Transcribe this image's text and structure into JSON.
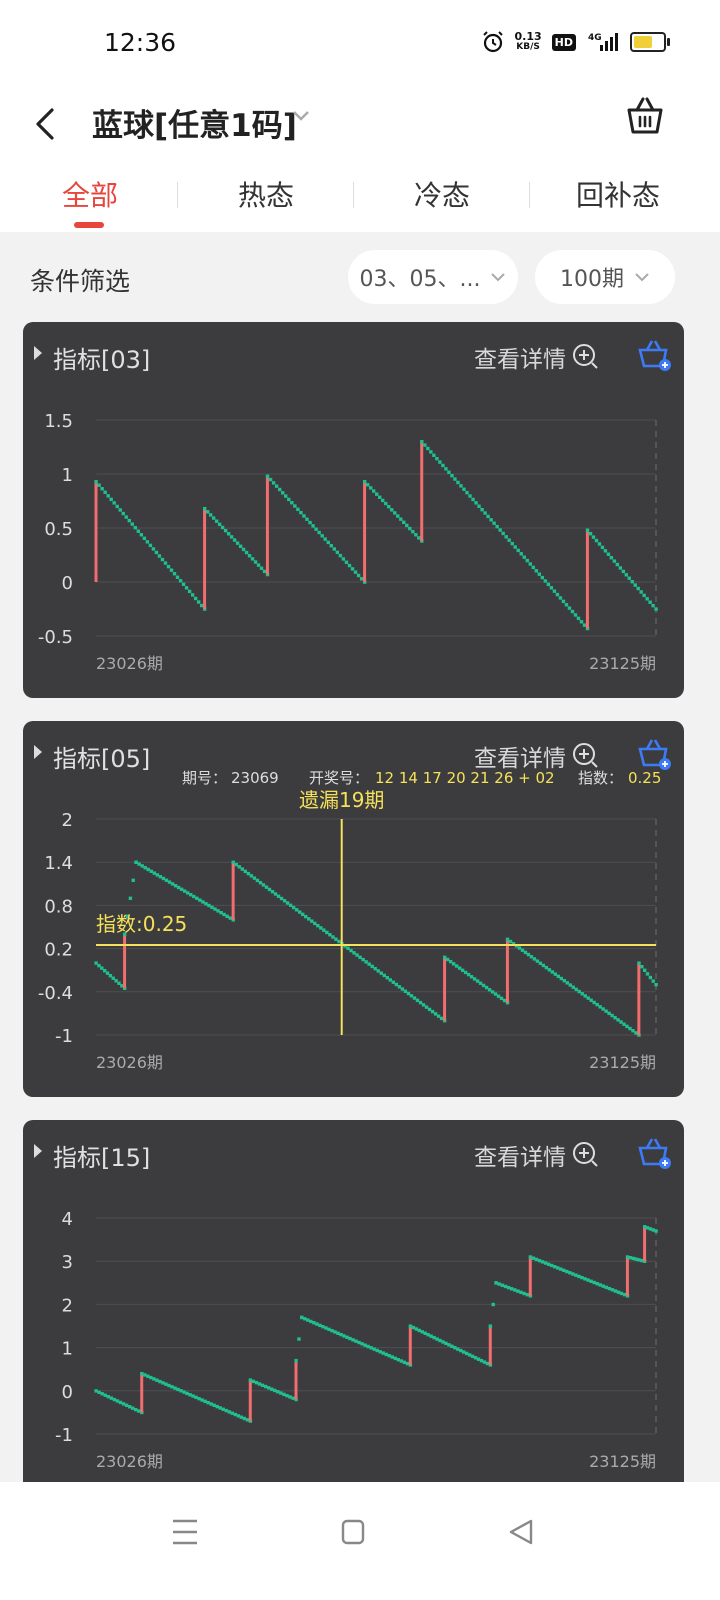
{
  "status": {
    "time": "12:36",
    "net_speed": "0.13",
    "net_unit": "KB/S",
    "hd": "HD",
    "signal": "4G"
  },
  "header": {
    "title": "蓝球[任意1码]"
  },
  "tabs": [
    {
      "label": "全部"
    },
    {
      "label": "热态"
    },
    {
      "label": "冷态"
    },
    {
      "label": "回补态"
    }
  ],
  "filter": {
    "label": "条件筛选",
    "numbers_value": "03、05、...",
    "period_value": "100期"
  },
  "cards": [
    {
      "title": "指标[03]",
      "detail": "查看详情"
    },
    {
      "title": "指标[05]",
      "detail": "查看详情"
    },
    {
      "title": "指标[15]",
      "detail": "查看详情"
    }
  ],
  "colors": {
    "accent": "#e8453c",
    "up": "#f26d6d",
    "down": "#1fbf8f",
    "crosshair": "#f5e15a",
    "card_bg": "#3c3c3e",
    "icon_blue": "#3d7bf5"
  },
  "chart_data": [
    {
      "type": "line",
      "x_start_label": "23026期",
      "x_end_label": "23125期",
      "y_ticks": [
        "1.5",
        "1",
        "0.5",
        "0",
        "-0.5"
      ],
      "ylim": [
        -0.5,
        1.5
      ],
      "segments": [
        {
          "from": 0,
          "to": 0.93
        },
        {
          "from": 0.93,
          "to": -0.25
        },
        {
          "from": -0.25,
          "to": 0.68
        },
        {
          "from": 0.68,
          "to": 0.07
        },
        {
          "from": 0.07,
          "to": 0.98
        },
        {
          "from": 0.98,
          "to": 0.0
        },
        {
          "from": 0.0,
          "to": 0.93
        },
        {
          "from": 0.93,
          "to": 0.38
        },
        {
          "from": 0.38,
          "to": 1.3
        },
        {
          "from": 1.3,
          "to": -0.43
        },
        {
          "from": -0.43,
          "to": 0.48
        },
        {
          "from": 0.48,
          "to": -0.25
        }
      ],
      "periods": [
        0,
        0,
        20,
        20,
        30,
        30,
        48,
        48,
        57,
        57,
        86,
        86,
        98
      ],
      "values_x": [
        0,
        0,
        19,
        19,
        30,
        30,
        47,
        47,
        57,
        57,
        86,
        86,
        98
      ]
    },
    {
      "type": "line",
      "x_start_label": "23026期",
      "x_end_label": "23125期",
      "y_ticks": [
        "2",
        "1.4",
        "0.8",
        "0.2",
        "-0.4",
        "-1"
      ],
      "ylim": [
        -1,
        2
      ],
      "tooltip": {
        "period_label": "期号：",
        "period": "23069",
        "draw_label": "开奖号：",
        "draw": "12 14 17 20 21 26 + 02",
        "index_label": "指数：",
        "index": "0.25"
      },
      "crosshair": {
        "omission_label": "遗漏19期",
        "index_label": "指数:0.25",
        "x_index": 43,
        "y_value": 0.25
      },
      "points": [
        [
          0,
          0.0
        ],
        [
          5,
          -0.35
        ],
        [
          5,
          0.4
        ],
        [
          7,
          1.4
        ],
        [
          24,
          0.6
        ],
        [
          24,
          1.4
        ],
        [
          61,
          -0.8
        ],
        [
          61,
          0.08
        ],
        [
          72,
          -0.55
        ],
        [
          72,
          0.33
        ],
        [
          95,
          -1.0
        ],
        [
          95,
          0.0
        ],
        [
          98,
          -0.3
        ]
      ]
    },
    {
      "type": "line",
      "x_start_label": "23026期",
      "x_end_label": "23125期",
      "y_ticks": [
        "4",
        "3",
        "2",
        "1",
        "0",
        "-1"
      ],
      "ylim": [
        -1,
        4
      ],
      "points": [
        [
          0,
          0.0
        ],
        [
          8,
          -0.5
        ],
        [
          8,
          0.4
        ],
        [
          27,
          -0.7
        ],
        [
          27,
          0.25
        ],
        [
          35,
          -0.2
        ],
        [
          35,
          0.7
        ],
        [
          36,
          1.7
        ],
        [
          55,
          0.6
        ],
        [
          55,
          1.5
        ],
        [
          69,
          0.6
        ],
        [
          69,
          1.5
        ],
        [
          70,
          2.5
        ],
        [
          76,
          2.2
        ],
        [
          76,
          3.1
        ],
        [
          93,
          2.2
        ],
        [
          93,
          3.1
        ],
        [
          96,
          3.0
        ],
        [
          96,
          3.8
        ],
        [
          98,
          3.7
        ]
      ]
    }
  ]
}
